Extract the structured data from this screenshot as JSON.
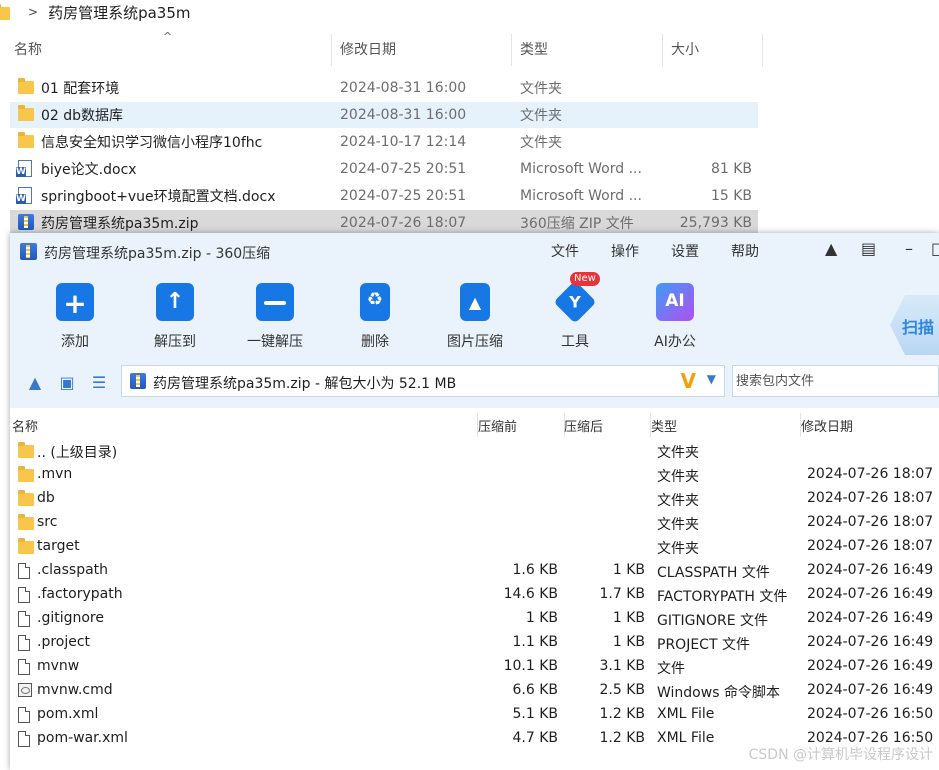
{
  "explorer": {
    "breadcrumb": "药房管理系统pa35m",
    "columns": {
      "name": "名称",
      "modified": "修改日期",
      "type": "类型",
      "size": "大小"
    },
    "rows": [
      {
        "name": "01 配套环境",
        "date": "2024-08-31 16:00",
        "type": "文件夹",
        "size": "",
        "icon": "folder-icon"
      },
      {
        "name": "02 db数据库",
        "date": "2024-08-31 16:00",
        "type": "文件夹",
        "size": "",
        "icon": "folder-icon"
      },
      {
        "name": "信息安全知识学习微信小程序10fhc",
        "date": "2024-10-17 12:14",
        "type": "文件夹",
        "size": "",
        "icon": "folder-icon"
      },
      {
        "name": "biye论文.docx",
        "date": "2024-07-25 20:51",
        "type": "Microsoft Word ...",
        "size": "81 KB",
        "icon": "word-doc-icon"
      },
      {
        "name": "springboot+vue环境配置文档.docx",
        "date": "2024-07-25 20:51",
        "type": "Microsoft Word ...",
        "size": "15 KB",
        "icon": "word-doc-icon"
      },
      {
        "name": "药房管理系统pa35m.zip",
        "date": "2024-07-26 18:07",
        "type": "360压缩 ZIP 文件",
        "size": "25,793 KB",
        "icon": "zip-file-icon"
      }
    ]
  },
  "zip": {
    "title": "药房管理系统pa35m.zip - 360压缩",
    "menu": [
      "文件",
      "操作",
      "设置",
      "帮助"
    ],
    "toolbar": [
      {
        "label": "添加",
        "icon": "add-icon"
      },
      {
        "label": "解压到",
        "icon": "extract-to-icon"
      },
      {
        "label": "一键解压",
        "icon": "one-click-extract-icon"
      },
      {
        "label": "删除",
        "icon": "delete-icon"
      },
      {
        "label": "图片压缩",
        "icon": "image-compress-icon"
      },
      {
        "label": "工具",
        "icon": "tools-icon"
      },
      {
        "label": "AI办公",
        "icon": "ai-office-icon"
      }
    ],
    "new_badge": "New",
    "scan_label": "扫描",
    "address": "药房管理系统pa35m.zip - 解包大小为 52.1 MB",
    "search_placeholder": "搜索包内文件",
    "columns": {
      "name": "名称",
      "orig": "压缩前",
      "comp": "压缩后",
      "type": "类型",
      "date": "修改日期"
    },
    "rows": [
      {
        "name": ".. (上级目录)",
        "orig": "",
        "comp": "",
        "type": "文件夹",
        "date": "",
        "icon": "folder-icon"
      },
      {
        "name": ".mvn",
        "orig": "",
        "comp": "",
        "type": "文件夹",
        "date": "2024-07-26 18:07",
        "icon": "folder-icon"
      },
      {
        "name": "db",
        "orig": "",
        "comp": "",
        "type": "文件夹",
        "date": "2024-07-26 18:07",
        "icon": "folder-icon"
      },
      {
        "name": "src",
        "orig": "",
        "comp": "",
        "type": "文件夹",
        "date": "2024-07-26 18:07",
        "icon": "folder-icon"
      },
      {
        "name": "target",
        "orig": "",
        "comp": "",
        "type": "文件夹",
        "date": "2024-07-26 18:07",
        "icon": "folder-icon"
      },
      {
        "name": ".classpath",
        "orig": "1.6 KB",
        "comp": "1 KB",
        "type": "CLASSPATH 文件",
        "date": "2024-07-26 16:49",
        "icon": "file-icon"
      },
      {
        "name": ".factorypath",
        "orig": "14.6 KB",
        "comp": "1.7 KB",
        "type": "FACTORYPATH 文件",
        "date": "2024-07-26 16:49",
        "icon": "file-icon"
      },
      {
        "name": ".gitignore",
        "orig": "1 KB",
        "comp": "1 KB",
        "type": "GITIGNORE 文件",
        "date": "2024-07-26 16:49",
        "icon": "file-icon"
      },
      {
        "name": ".project",
        "orig": "1.1 KB",
        "comp": "1 KB",
        "type": "PROJECT 文件",
        "date": "2024-07-26 16:49",
        "icon": "file-icon"
      },
      {
        "name": "mvnw",
        "orig": "10.1 KB",
        "comp": "3.1 KB",
        "type": "文件",
        "date": "2024-07-26 16:49",
        "icon": "file-icon"
      },
      {
        "name": "mvnw.cmd",
        "orig": "6.6 KB",
        "comp": "2.5 KB",
        "type": "Windows 命令脚本",
        "date": "2024-07-26 16:49",
        "icon": "cmd-script-icon"
      },
      {
        "name": "pom.xml",
        "orig": "5.1 KB",
        "comp": "1.2 KB",
        "type": "XML File",
        "date": "2024-07-26 16:50",
        "icon": "file-icon"
      },
      {
        "name": "pom-war.xml",
        "orig": "4.7 KB",
        "comp": "1.2 KB",
        "type": "XML File",
        "date": "2024-07-26 16:50",
        "icon": "file-icon"
      }
    ]
  },
  "watermark": "CSDN @计算机毕设程序设计"
}
